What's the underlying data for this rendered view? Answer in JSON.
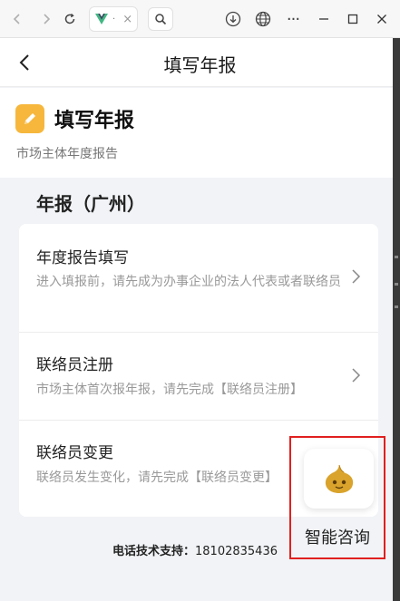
{
  "browser": {
    "tab_label": "V",
    "tab_dots": "·",
    "tab_close": "×",
    "nav_back": "‹",
    "nav_forward": "›",
    "reload": "↻",
    "menu": "···",
    "minimize": "−",
    "maximize": "□",
    "close": "✕"
  },
  "header": {
    "title": "填写年报"
  },
  "intro": {
    "title": "填写年报",
    "subtitle": "市场主体年度报告"
  },
  "section": {
    "title": "年报（广州）"
  },
  "items": [
    {
      "title": "年度报告填写",
      "desc": "进入填报前，请先成为办事企业的法人代表或者联络员"
    },
    {
      "title": "联络员注册",
      "desc": "市场主体首次报年报，请先完成【联络员注册】"
    },
    {
      "title": "联络员变更",
      "desc": "联络员发生变化，请先完成【联络员变更】"
    }
  ],
  "support": {
    "label": "电话技术支持：",
    "number": "18102835436"
  },
  "assistant": {
    "label": "智能咨询"
  },
  "colors": {
    "accent_orange": "#f6b73c",
    "highlight_red": "#e0201f",
    "page_bg": "#f1f3f6"
  }
}
